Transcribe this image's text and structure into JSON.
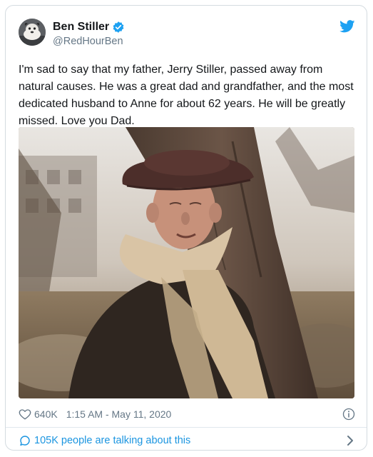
{
  "tweet": {
    "author": {
      "display_name": "Ben Stiller",
      "handle": "@RedHourBen",
      "verified": true
    },
    "text": "I'm sad to say that my father, Jerry Stiller, passed away from\nnatural causes. He was a great dad and grandfather,  and the most\ndedicated husband to Anne for about 62 years. He will be greatly\nmissed. Love you Dad.",
    "likes": "640K",
    "timestamp": "1:15 AM - May 11, 2020",
    "conversation_link": "105K people are talking about this"
  },
  "colors": {
    "accent": "#1b95e0",
    "verified_badge": "#1da1f2",
    "secondary_text": "#657786",
    "primary_text": "#14171a",
    "border": "#d4dbe0"
  },
  "icons": {
    "logo": "twitter-bird-icon",
    "verified": "verified-badge-icon",
    "like": "heart-icon",
    "info": "info-icon",
    "conversation": "speech-bubble-icon",
    "more": "chevron-right-icon"
  }
}
